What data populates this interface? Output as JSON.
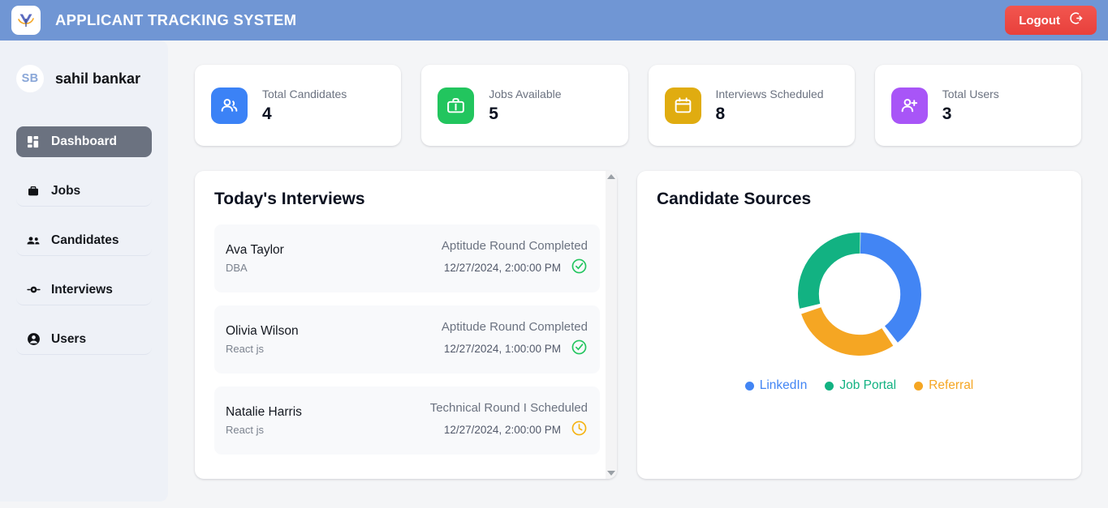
{
  "header": {
    "app_title": "APPLICANT TRACKING SYSTEM",
    "logo_icon": "v-bird-logo-icon",
    "logout_label": "Logout",
    "logout_icon": "logout-arrow-icon",
    "background_color": "#7096d4",
    "logout_color": "#ea4a45"
  },
  "sidebar": {
    "avatar_initials": "SB",
    "user_name": "sahil bankar",
    "items": [
      {
        "label": "Dashboard",
        "icon": "dashboard-grid-icon",
        "active": true
      },
      {
        "label": "Jobs",
        "icon": "briefcase-icon",
        "active": false
      },
      {
        "label": "Candidates",
        "icon": "people-icon",
        "active": false
      },
      {
        "label": "Interviews",
        "icon": "eye-person-icon",
        "active": false
      },
      {
        "label": "Users",
        "icon": "account-circle-icon",
        "active": false
      }
    ],
    "active_background": "#6b7280",
    "background_color": "#eef1f7"
  },
  "stats": [
    {
      "label": "Total Candidates",
      "value": "4",
      "icon": "group-people-icon",
      "color": "#3b82f6"
    },
    {
      "label": "Jobs Available",
      "value": "5",
      "icon": "briefcase-icon",
      "color": "#22c55e"
    },
    {
      "label": "Interviews Scheduled",
      "value": "8",
      "icon": "calendar-icon",
      "color": "#e0ac10"
    },
    {
      "label": "Total Users",
      "value": "3",
      "icon": "person-add-icon",
      "color": "#a855f7"
    }
  ],
  "interviews_panel": {
    "title": "Today's Interviews",
    "scrollbar_up_icon": "scroll-up-arrow-icon",
    "scrollbar_down_icon": "scroll-down-arrow-icon",
    "items": [
      {
        "name": "Ava Taylor",
        "role": "DBA",
        "status": "Aptitude Round Completed",
        "time": "12/27/2024, 2:00:00 PM",
        "status_icon": "check-circle-icon",
        "status_color": "#22c55e"
      },
      {
        "name": "Olivia Wilson",
        "role": "React js",
        "status": "Aptitude Round Completed",
        "time": "12/27/2024, 1:00:00 PM",
        "status_icon": "check-circle-icon",
        "status_color": "#22c55e"
      },
      {
        "name": "Natalie Harris",
        "role": "React js",
        "status": "Technical Round I Scheduled",
        "time": "12/27/2024, 2:00:00 PM",
        "status_icon": "clock-icon",
        "status_color": "#f5b312"
      }
    ]
  },
  "sources_panel": {
    "title": "Candidate Sources"
  },
  "chart_data": {
    "type": "pie",
    "title": "Candidate Sources",
    "labels": [
      "LinkedIn",
      "Job Portal",
      "Referral"
    ],
    "values": [
      40,
      30,
      30
    ],
    "colors": [
      "#4285f4",
      "#12b282",
      "#f5a623"
    ],
    "donut": true,
    "legend_position": "bottom",
    "grid": false
  }
}
